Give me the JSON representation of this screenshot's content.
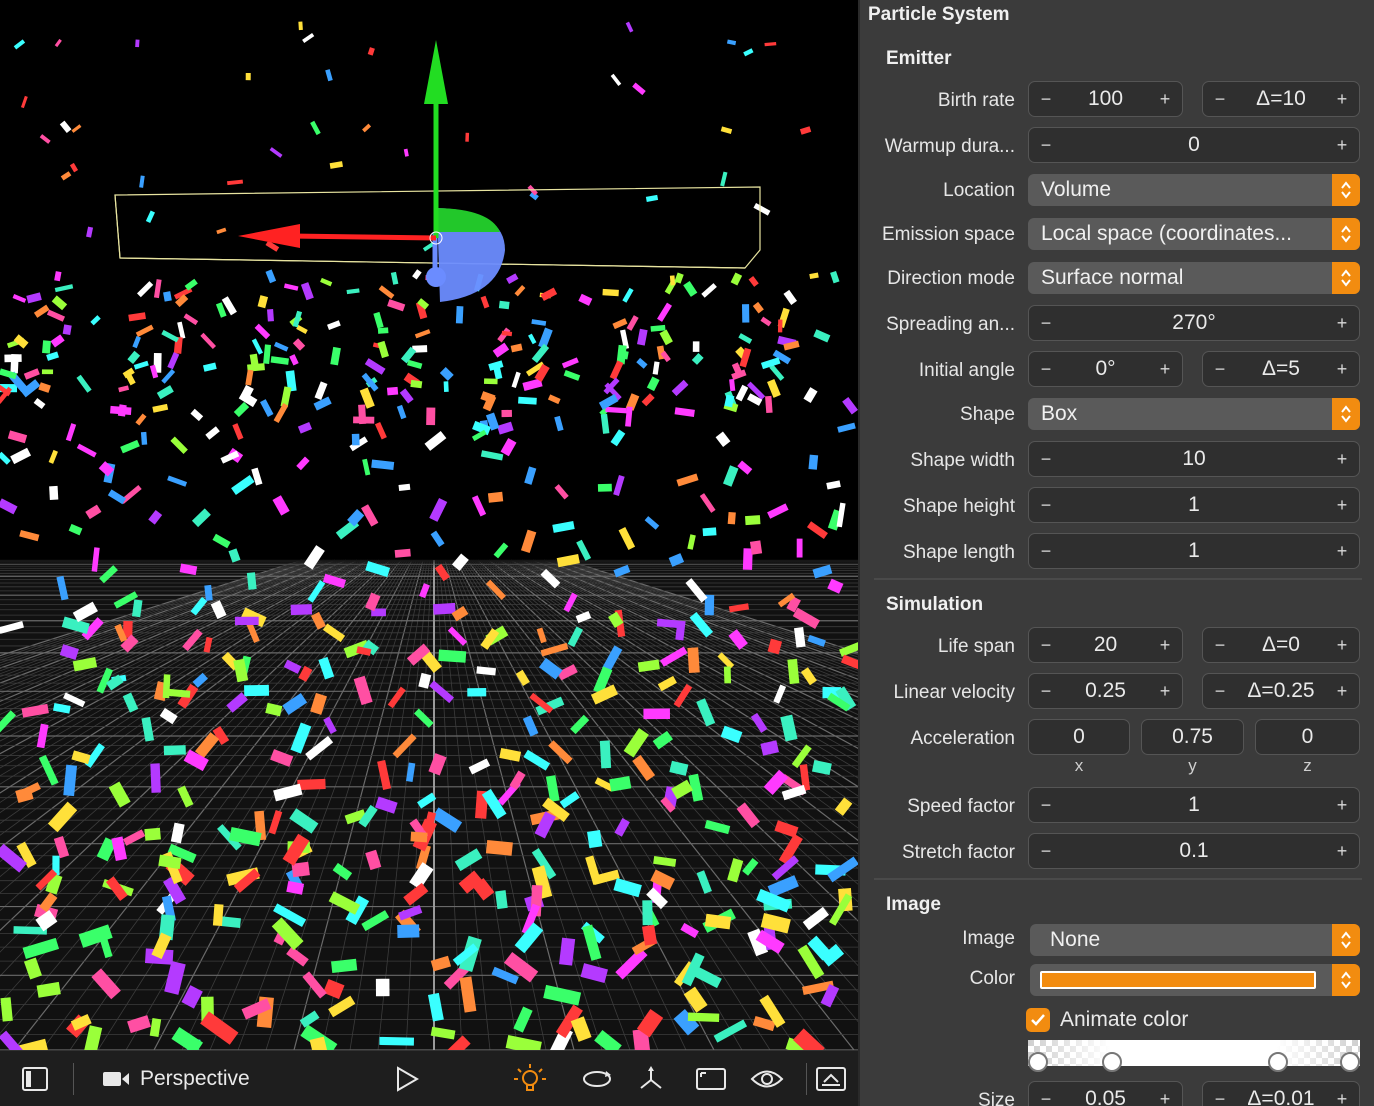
{
  "inspector": {
    "title": "Particle System",
    "emitter": {
      "title": "Emitter",
      "birth_rate": {
        "label": "Birth rate",
        "value": "100",
        "delta": "Δ=10"
      },
      "warmup": {
        "label": "Warmup dura...",
        "value": "0"
      },
      "location": {
        "label": "Location",
        "value": "Volume"
      },
      "emission_space": {
        "label": "Emission space",
        "value": "Local space (coordinates..."
      },
      "direction_mode": {
        "label": "Direction mode",
        "value": "Surface normal"
      },
      "spreading": {
        "label": "Spreading an...",
        "value": "270°"
      },
      "initial_angle": {
        "label": "Initial angle",
        "value": "0°",
        "delta": "Δ=5"
      },
      "shape": {
        "label": "Shape",
        "value": "Box"
      },
      "shape_width": {
        "label": "Shape width",
        "value": "10"
      },
      "shape_height": {
        "label": "Shape height",
        "value": "1"
      },
      "shape_length": {
        "label": "Shape length",
        "value": "1"
      }
    },
    "simulation": {
      "title": "Simulation",
      "life_span": {
        "label": "Life span",
        "value": "20",
        "delta": "Δ=0"
      },
      "linear_velocity": {
        "label": "Linear velocity",
        "value": "0.25",
        "delta": "Δ=0.25"
      },
      "acceleration": {
        "label": "Acceleration",
        "x": "0",
        "y": "0.75",
        "z": "0",
        "x_label": "x",
        "y_label": "y",
        "z_label": "z"
      },
      "speed_factor": {
        "label": "Speed factor",
        "value": "1"
      },
      "stretch_factor": {
        "label": "Stretch factor",
        "value": "0.1"
      }
    },
    "image": {
      "title": "Image",
      "image": {
        "label": "Image",
        "value": "None"
      },
      "color": {
        "label": "Color",
        "swatch": "#f28c10"
      },
      "animate_color": {
        "label": "Animate color",
        "checked": true
      },
      "size": {
        "label": "Size",
        "value": "0.05",
        "delta": "Δ=0.01"
      }
    },
    "stepper": {
      "minus": "−",
      "plus": "+"
    }
  },
  "toolbar": {
    "camera_label": "Perspective",
    "icons": [
      "sidebar-icon",
      "camera-icon",
      "play-icon",
      "light-icon",
      "orbit-icon",
      "axes-icon",
      "frame-icon",
      "eye-icon",
      "scene-graph-icon"
    ]
  },
  "colors": {
    "accent": "#f28c10",
    "panel_bg": "#3b3b3b",
    "gizmo_x": "#ff2222",
    "gizmo_y": "#22dd22",
    "gizmo_z": "#5577ff"
  }
}
